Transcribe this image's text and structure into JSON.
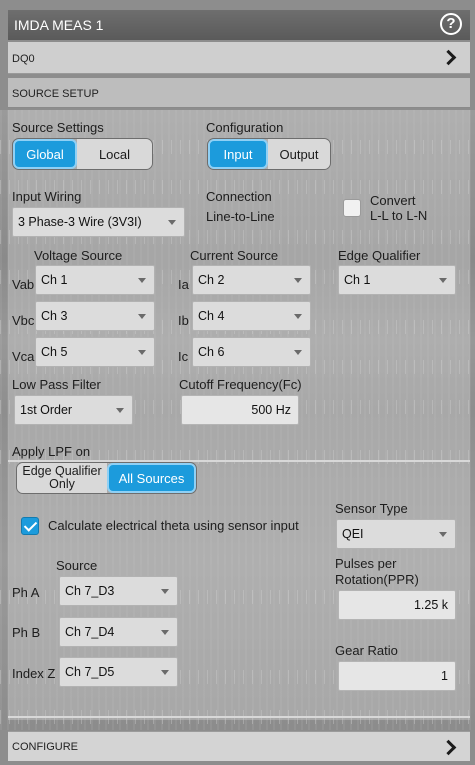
{
  "window": {
    "title": "IMDA MEAS 1"
  },
  "dq0": {
    "label": "DQ0"
  },
  "source_setup": {
    "label": "SOURCE SETUP"
  },
  "source_settings": {
    "label": "Source Settings",
    "options": [
      "Global",
      "Local"
    ],
    "selected": "Global"
  },
  "configuration": {
    "label": "Configuration",
    "options": [
      "Input",
      "Output"
    ],
    "selected": "Input"
  },
  "input_wiring": {
    "label": "Input Wiring",
    "value": "3 Phase-3 Wire (3V3I)"
  },
  "connection": {
    "label": "Connection",
    "value": "Line-to-Line"
  },
  "convert": {
    "label_line1": "Convert",
    "label_line2": "L-L to L-N",
    "checked": false
  },
  "voltage_source": {
    "label": "Voltage Source",
    "rows": [
      {
        "prefix": "Vab",
        "value": "Ch 1"
      },
      {
        "prefix": "Vbc",
        "value": "Ch 3"
      },
      {
        "prefix": "Vca",
        "value": "Ch 5"
      }
    ]
  },
  "current_source": {
    "label": "Current Source",
    "rows": [
      {
        "prefix": "Ia",
        "value": "Ch 2"
      },
      {
        "prefix": "Ib",
        "value": "Ch 4"
      },
      {
        "prefix": "Ic",
        "value": "Ch 6"
      }
    ]
  },
  "edge_qualifier": {
    "label": "Edge Qualifier",
    "value": "Ch 1"
  },
  "low_pass_filter": {
    "label": "Low Pass Filter",
    "value": "1st Order"
  },
  "cutoff": {
    "label": "Cutoff Frequency(Fc)",
    "value": "500 Hz"
  },
  "apply_lpf": {
    "label": "Apply LPF on",
    "options": [
      "Edge Qualifier Only",
      "All Sources"
    ],
    "option1_line1": "Edge Qualifier",
    "option1_line2": "Only",
    "selected": "All Sources"
  },
  "calc_theta": {
    "label": "Calculate electrical theta using sensor input",
    "checked": true
  },
  "sensor_source": {
    "label": "Source",
    "rows": [
      {
        "prefix": "Ph A",
        "value": "Ch 7_D3"
      },
      {
        "prefix": "Ph B",
        "value": "Ch 7_D4"
      },
      {
        "prefix": "Index Z",
        "value": "Ch 7_D5"
      }
    ]
  },
  "sensor_type": {
    "label": "Sensor Type",
    "value": "QEI"
  },
  "ppr": {
    "label_line1": "Pulses per",
    "label_line2": "Rotation(PPR)",
    "value": "1.25 k"
  },
  "gear_ratio": {
    "label": "Gear Ratio",
    "value": "1"
  },
  "configure": {
    "label": "CONFIGURE"
  },
  "colors": {
    "accent": "#1c9bdc",
    "titlebar": "#5f5f5f",
    "panel": "#c8c8c8"
  },
  "icons": {
    "help": "help-circle-icon",
    "chevron": "chevron-right-icon",
    "dropdown": "chevron-down-icon",
    "check": "check-icon"
  }
}
